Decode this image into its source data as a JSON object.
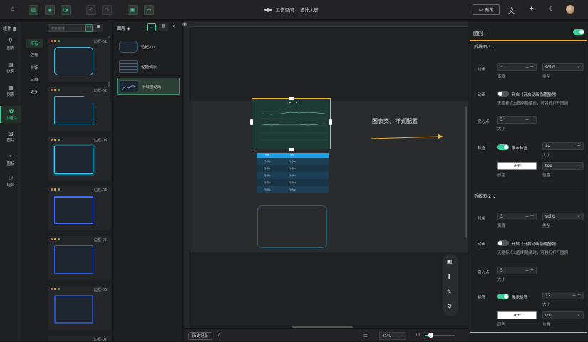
{
  "topbar": {
    "workspace": "工作空间 -",
    "project": "设计大屏",
    "preview": "预览"
  },
  "leftnav": {
    "header": "组件",
    "items": [
      "图表",
      "信息",
      "列表",
      "小组件",
      "图片",
      "图标",
      "组合"
    ]
  },
  "components": {
    "search_placeholder": "搜索组件",
    "subcats": [
      "所有",
      "边框",
      "装饰",
      "三维",
      "更多"
    ],
    "cards": [
      "边框-01",
      "边框-02",
      "边框-03",
      "边框-04",
      "边框-05",
      "边框-06",
      "边框-07"
    ]
  },
  "layers": {
    "header": "图层",
    "items": [
      "边框-01",
      "轮播列表",
      "折线图动画"
    ]
  },
  "canvas": {
    "annotation": "图表类，样式配置",
    "table_headers": [
      "列1",
      "列2"
    ],
    "table_rows": [
      [
        "行1列1",
        "行1列2"
      ],
      [
        "行2列1",
        "行2列2"
      ],
      [
        "行3列1",
        "行3列2"
      ],
      [
        "行4列1",
        "行4列2"
      ],
      [
        "行5列1",
        "行5列2"
      ]
    ]
  },
  "bottombar": {
    "history": "历史记录",
    "zoom": "41%"
  },
  "config": {
    "header": "图例",
    "sections": [
      {
        "title": "折线图-1",
        "line_label": "线条",
        "width_value": "3",
        "width_label": "宽度",
        "type_value": "solid",
        "type_label": "类型",
        "anim_label": "动画",
        "anim_on": "开启（开启动画隐藏图例）",
        "anim_note": "无隐标点击图例隐藏时，可强行打开图例",
        "point_label": "实心点",
        "size_value": "5",
        "size_label": "大小",
        "tag_label": "标签",
        "show_tag": "展示标签",
        "tag_size": "12",
        "tag_size_label": "大小",
        "color_value": "#fff",
        "color_label": "颜色",
        "pos_value": "top",
        "pos_label": "位置"
      },
      {
        "title": "折线图-2",
        "line_label": "线条",
        "width_value": "3",
        "width_label": "宽度",
        "type_value": "solid",
        "type_label": "类型",
        "anim_label": "动画",
        "anim_on": "开启（开启动画隐藏图例）",
        "anim_note": "无隐标点击图例隐藏时，可强行打开图例",
        "point_label": "实心点",
        "size_value": "5",
        "size_label": "大小",
        "tag_label": "标签",
        "show_tag": "展示标签",
        "tag_size": "12",
        "tag_size_label": "大小",
        "color_value": "#fff",
        "color_label": "颜色",
        "pos_value": "top",
        "pos_label": "位置"
      }
    ]
  },
  "colors": {
    "accent": "#3ad09a",
    "highlight": "#f0b020"
  }
}
